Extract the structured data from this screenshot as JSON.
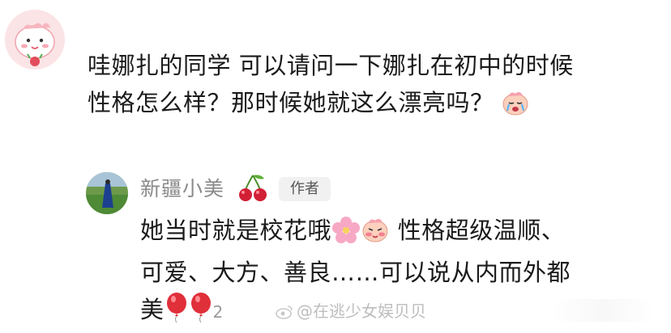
{
  "comment": {
    "line1": "哇娜扎的同学 可以请问一下娜扎在初中的时候",
    "line2": "性格怎么样？那时候她就这么漂亮吗？",
    "emoji": "crying-face-icon"
  },
  "reply": {
    "author": "新疆小美",
    "badge": "作者",
    "part1": "她当时就是校花哦",
    "part2": " 性格超级温顺、",
    "line2": "可爱、大方、善良……可以说从内而外都",
    "line3": "美",
    "trailing": "2"
  },
  "watermark": {
    "text": "@在逃少女娱贝贝"
  },
  "colors": {
    "avatar_bg": "#fbe4e6",
    "balloon": "#e0303a",
    "name": "#8a8a8a",
    "badge_bg": "#f1f1f1"
  }
}
